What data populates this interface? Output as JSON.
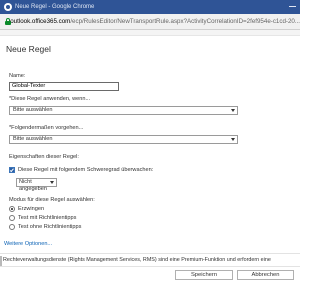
{
  "window": {
    "title": "Neue Regel - Google Chrome"
  },
  "address_bar": {
    "url_domain": "outlook.office365.com",
    "url_path": "/ecp/RulesEditor/NewTransportRule.aspx?ActivityCorrelationID=2fef954e-c1cd-20..."
  },
  "page": {
    "title": "Neue Regel"
  },
  "form": {
    "name_label": "Name:",
    "name_value": "Global-Texter",
    "apply_label": "*Diese Regel anwenden, wenn...",
    "apply_select": "Bitte auswählen",
    "action_label": "*Folgendermaßen vorgehen...",
    "action_select": "Bitte auswählen",
    "properties_label": "Eigenschaften dieser Regel:",
    "severity_checkbox_label": "Diese Regel mit folgendem Schweregrad überwachen:",
    "severity_checked": true,
    "severity_select": "Nicht angegeben",
    "mode_label": "Modus für diese Regel auswählen:",
    "modes": [
      {
        "label": "Erzwingen",
        "selected": true
      },
      {
        "label": "Test mit Richtlinientipps",
        "selected": false
      },
      {
        "label": "Test ohne Richtlinientipps",
        "selected": false
      }
    ],
    "more_options_link": "Weitere Optionen..."
  },
  "footer": {
    "notice": "Rechteverwaltungsdienste (Rights Management Services, RMS) sind eine Premium-Funktion und erfordern eine",
    "save_button": "Speichern",
    "cancel_button": "Abbrechen"
  },
  "colors": {
    "titlebar": "#2f5496",
    "link": "#0b62b5",
    "secure_lock": "#0a8a2a"
  }
}
